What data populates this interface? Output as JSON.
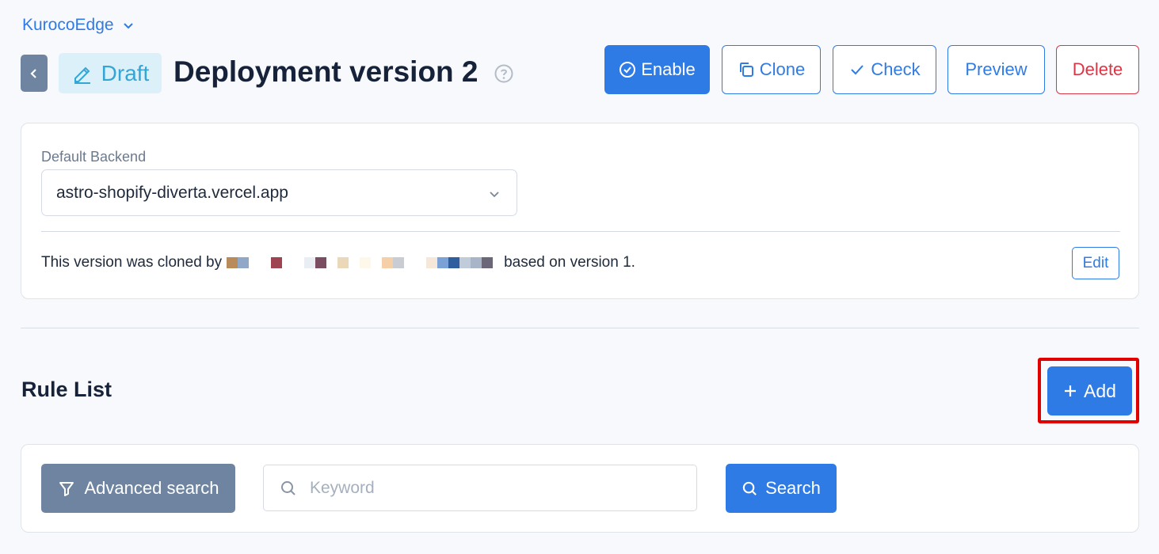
{
  "project": {
    "name": "KurocoEdge",
    "icon": "chevron-down-icon"
  },
  "header": {
    "back_icon": "chevron-left-icon",
    "status": "Draft",
    "status_icon": "pencil-icon",
    "title": "Deployment version 2",
    "help_icon": "question-circle-icon"
  },
  "actions": {
    "enable": "Enable",
    "clone": "Clone",
    "check": "Check",
    "preview": "Preview",
    "delete": "Delete"
  },
  "backend": {
    "label": "Default Backend",
    "selected": "astro-shopify-diverta.vercel.app",
    "clone_prefix": "This version was cloned by",
    "clone_suffix": "based on version 1.",
    "edit_label": "Edit"
  },
  "rules": {
    "title": "Rule List",
    "add_label": "Add"
  },
  "search": {
    "advanced_label": "Advanced search",
    "placeholder": "Keyword",
    "value": "",
    "search_label": "Search"
  },
  "colors": {
    "primary": "#2f7be6",
    "danger": "#dc3545",
    "secondary": "#6e84a0",
    "draft_bg": "#dcf0fa",
    "draft_text": "#33a6d6",
    "highlight": "#e00000"
  }
}
